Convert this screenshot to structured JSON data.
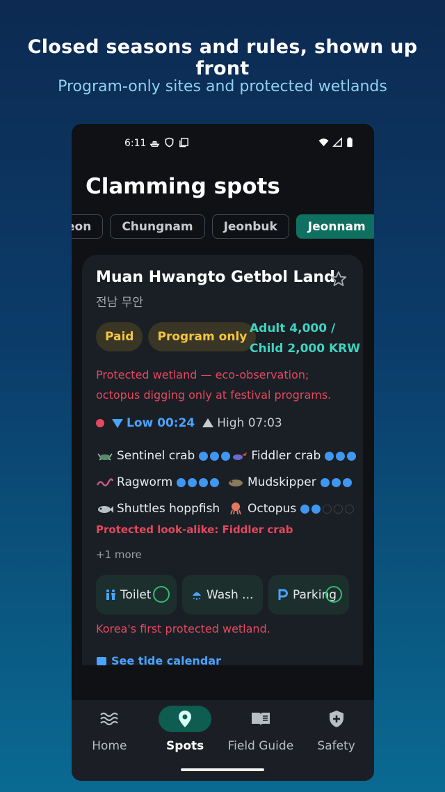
{
  "promo": {
    "title": "Closed seasons and rules, shown up front",
    "subtitle": "Program-only sites and protected wetlands"
  },
  "status_bar": {
    "time": "6:11"
  },
  "screen": {
    "title": "Clamming spots"
  },
  "region_chips": [
    {
      "label": "eon",
      "active": false
    },
    {
      "label": "Chungnam",
      "active": false
    },
    {
      "label": "Jeonbuk",
      "active": false
    },
    {
      "label": "Jeonnam",
      "active": true
    }
  ],
  "spot": {
    "name": "Muan Hwangto Getbol Land",
    "region": "전남 무안",
    "badges": [
      "Paid",
      "Program only"
    ],
    "price_line1": "Adult 4,000 /",
    "price_line2": "Child 2,000 KRW",
    "warning": "Protected wetland — eco-observation; octopus digging only at festival programs.",
    "tide": {
      "low": "Low 00:24",
      "high": "High 07:03"
    },
    "species": [
      {
        "name": "Sentinel crab",
        "level": 3,
        "max": 3,
        "icon": "crab-icon"
      },
      {
        "name": "Fiddler crab",
        "level": 3,
        "max": 3,
        "icon": "fiddler-crab-icon"
      },
      {
        "name": "Ragworm",
        "level": 4,
        "max": 4,
        "icon": "worm-icon"
      },
      {
        "name": "Mudskipper",
        "level": 3,
        "max": 3,
        "icon": "fish-icon"
      },
      {
        "name": "Shuttles hoppfish",
        "level": 0,
        "max": 0,
        "icon": "fish-icon"
      },
      {
        "name": "Octopus",
        "level": 2,
        "max": 5,
        "icon": "octopus-icon"
      }
    ],
    "lookalike": "Protected look-alike: Fiddler crab",
    "more": "+1 more",
    "amenities": [
      {
        "label": "Toilet",
        "icon": "toilet-icon"
      },
      {
        "label": "Wash ...",
        "icon": "shower-icon"
      },
      {
        "label": "Parking",
        "icon": "parking-icon"
      }
    ],
    "note": "Korea's first protected wetland.",
    "calendar_link": "See tide calendar"
  },
  "nav": [
    {
      "label": "Home",
      "icon": "waves-icon",
      "active": false
    },
    {
      "label": "Spots",
      "icon": "location-pin-icon",
      "active": true
    },
    {
      "label": "Field Guide",
      "icon": "book-icon",
      "active": false
    },
    {
      "label": "Safety",
      "icon": "shield-plus-icon",
      "active": false
    }
  ],
  "colors": {
    "accent_teal": "#0f6f60",
    "warning_red": "#e5485f",
    "info_blue": "#4aa3ff",
    "badge_yellow": "#f4c542",
    "price_teal": "#40d3c0"
  }
}
